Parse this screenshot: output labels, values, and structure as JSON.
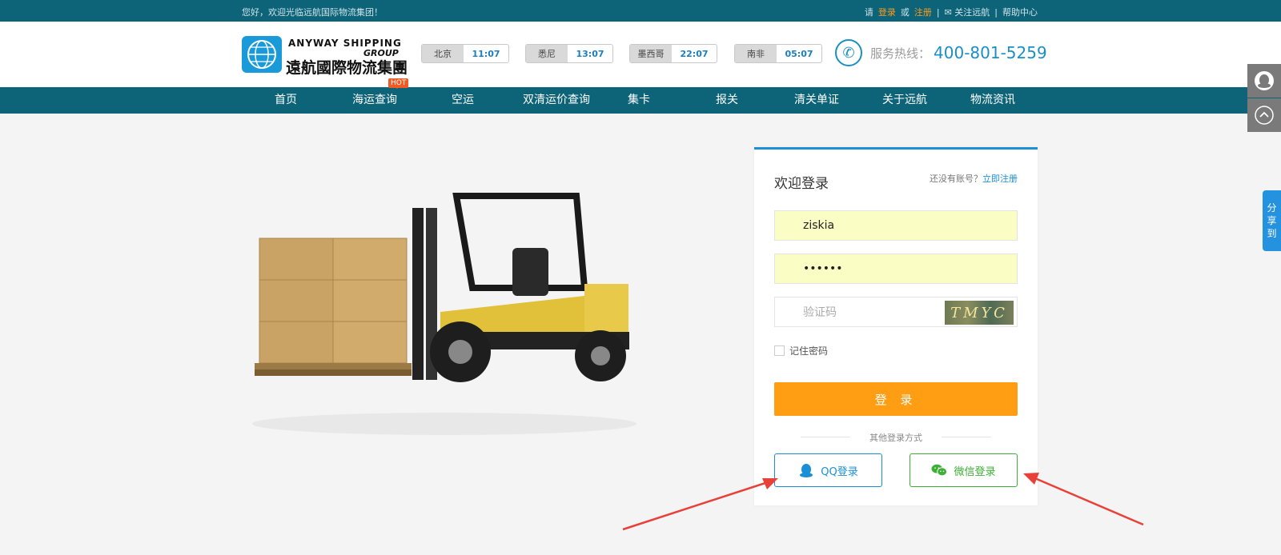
{
  "topbar": {
    "welcome": "您好，欢迎光临远航国际物流集团！",
    "please": "请",
    "login": "登录",
    "or": "或",
    "register": "注册",
    "sep1": "|",
    "follow": "关注远航",
    "sep2": "|",
    "help": "帮助中心"
  },
  "logo": {
    "en_line1": "ANYWAY SHIPPING",
    "en_line2": "GROUP",
    "cn": "遠航國際物流集團"
  },
  "clocks": [
    {
      "city": "北京",
      "time": "11:07"
    },
    {
      "city": "悉尼",
      "time": "13:07"
    },
    {
      "city": "墨西哥",
      "time": "22:07"
    },
    {
      "city": "南非",
      "time": "05:07"
    }
  ],
  "hotline": {
    "label": "服务热线：",
    "number": "400-801-5259"
  },
  "nav": {
    "items": [
      "首页",
      "海运查询",
      "空运",
      "双清运价查询",
      "集卡",
      "报关",
      "清关单证",
      "关于远航",
      "物流资讯"
    ],
    "hot_badge": "HOT"
  },
  "login": {
    "title": "欢迎登录",
    "no_account": "还没有账号？",
    "register_now": "立即注册",
    "username": "ziskia",
    "password": "••••••",
    "captcha_placeholder": "验证码",
    "captcha_text": "TMYC",
    "remember": "记住密码",
    "submit": "登 录",
    "other_methods": "其他登录方式",
    "qq": "QQ登录",
    "wechat": "微信登录"
  },
  "side": {
    "share": [
      "分",
      "享",
      "到"
    ]
  },
  "colors": {
    "brand_teal": "#0d6479",
    "accent_blue": "#1a8fd6",
    "login_orange": "#ff9d13",
    "wechat_green": "#3cb034",
    "annotation_red": "#e8413a"
  }
}
